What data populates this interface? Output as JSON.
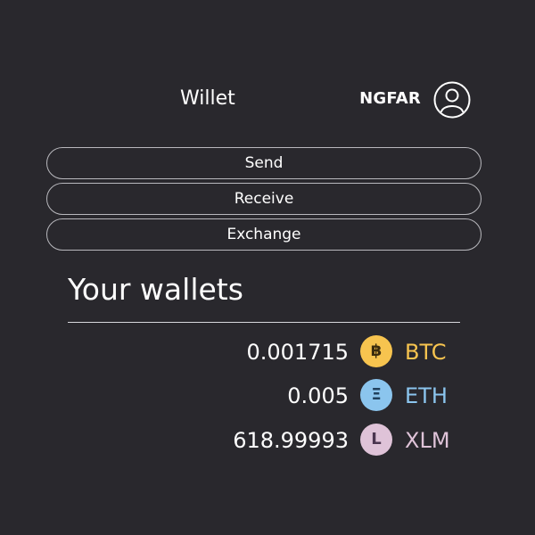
{
  "header": {
    "app_title": "Willet",
    "user_name": "NGFAR",
    "avatar_icon": "user-circle-icon"
  },
  "actions": {
    "send_label": "Send",
    "receive_label": "Receive",
    "exchange_label": "Exchange"
  },
  "wallets": {
    "title": "Your wallets",
    "items": [
      {
        "amount": "0.001715",
        "symbol": "BTC",
        "icon_glyph": "฿",
        "icon": "bitcoin-icon",
        "color": "#f7c44f",
        "text_color": "#3a2b0d"
      },
      {
        "amount": "0.005",
        "symbol": "ETH",
        "icon_glyph": "Ξ",
        "icon": "ethereum-icon",
        "color": "#8bc5ee",
        "text_color": "#21415d"
      },
      {
        "amount": "618.99993",
        "symbol": "XLM",
        "icon_glyph": "L",
        "icon": "stellar-icon",
        "color": "#dfc3d8",
        "text_color": "#4b3650"
      }
    ]
  },
  "theme": {
    "background": "#29282d",
    "button_border": "#b8b8bd",
    "text": "#ffffff"
  }
}
